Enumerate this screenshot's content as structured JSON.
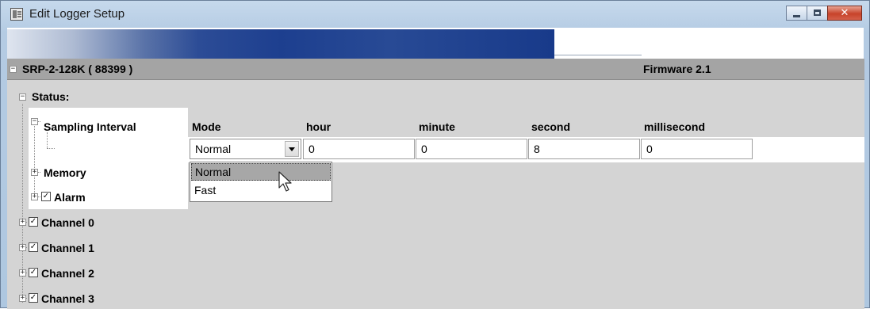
{
  "window": {
    "title": "Edit Logger Setup",
    "close_glyph": "✕"
  },
  "device": {
    "name": "SRP-2-128K ( 88399 )",
    "firmware": "Firmware 2.1"
  },
  "tree": {
    "status_label": "Status:",
    "sampling_label": "Sampling Interval",
    "memory_label": "Memory",
    "alarm_label": "Alarm",
    "channels": [
      "Channel 0",
      "Channel 1",
      "Channel 2",
      "Channel 3"
    ],
    "expand_glyph": "+",
    "collapse_glyph": "−",
    "check_glyph": "✓"
  },
  "sampling": {
    "columns": {
      "mode": "Mode",
      "hour": "hour",
      "minute": "minute",
      "second": "second",
      "millisecond": "millisecond"
    },
    "values": {
      "mode": "Normal",
      "hour": "0",
      "minute": "0",
      "second": "8",
      "millisecond": "0"
    },
    "mode_options": [
      "Normal",
      "Fast"
    ]
  },
  "colors": {
    "device_row_bg": "#a4a4a4",
    "tree_bg": "#d4d4d4",
    "highlight_bg": "#a7a7a7",
    "close_button": "#c7432a"
  }
}
